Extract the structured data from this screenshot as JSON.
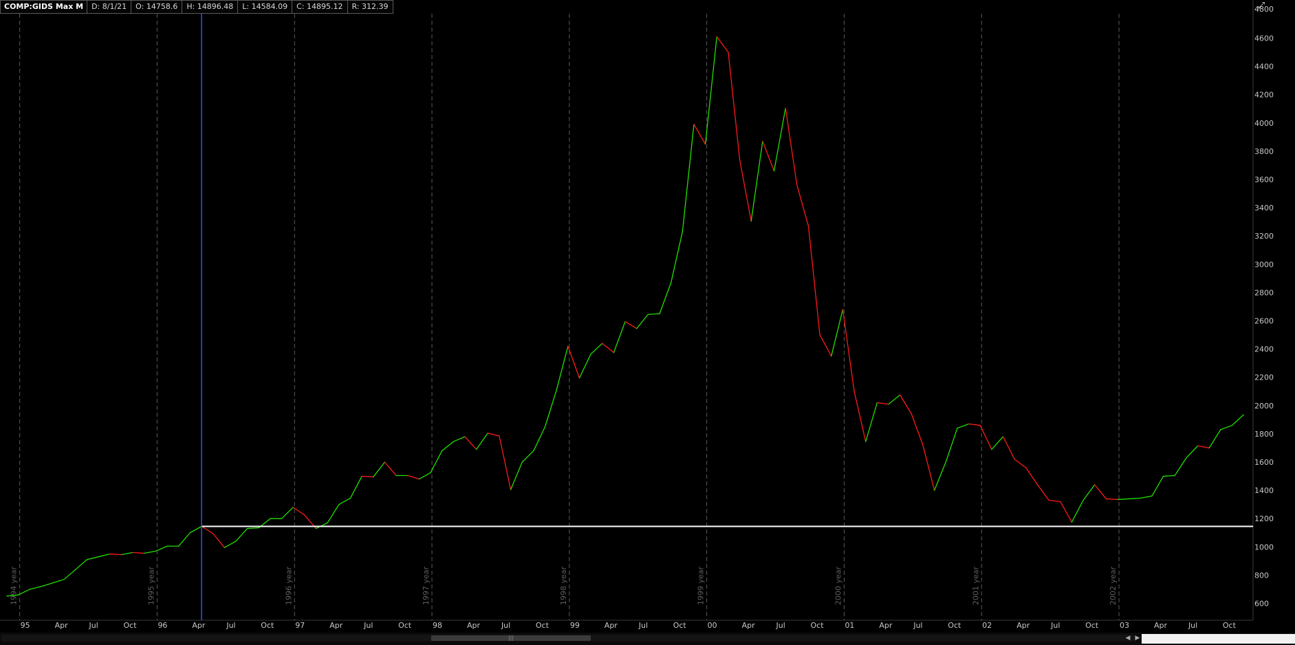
{
  "header": {
    "symbol": "COMP:GIDS Max M",
    "date": "D: 8/1/21",
    "open": "O: 14758.6",
    "high": "H: 14896.48",
    "low": "L: 14584.09",
    "close": "C: 14895.12",
    "range": "R: 312.39"
  },
  "colors": {
    "up": "#22e000",
    "down": "#ff1a1a",
    "background": "#000000",
    "axis_text": "#c8c8c8",
    "vertical_cursor": "#2a54ff",
    "horizontal_line": "#ffffff",
    "year_separator": "#5a5a5a",
    "year_label": "#5e5e5e"
  },
  "chart_data": {
    "type": "line",
    "ylim": [
      520,
      4720
    ],
    "y_ticks": [
      600,
      800,
      1000,
      1200,
      1400,
      1600,
      1800,
      2000,
      2200,
      2400,
      2600,
      2800,
      3000,
      3200,
      3400,
      3600,
      3800,
      4000,
      4200,
      4400,
      4600
    ],
    "y_tick_labels": [
      "600",
      "800",
      "1000",
      "1200",
      "1400",
      "1600",
      "1800",
      "2000",
      "2200",
      "2400",
      "2600",
      "2800",
      "3000",
      "3200",
      "3400",
      "3600",
      "3800",
      "4000",
      "4200",
      "4400",
      "4600"
    ],
    "top_partial_label": "4800",
    "x_start": "1994-12",
    "x_end": "2003-12",
    "x_tick_labels": [
      {
        "date": "1995-01",
        "label": "95"
      },
      {
        "date": "1995-04",
        "label": "Apr"
      },
      {
        "date": "1995-07",
        "label": "Jul"
      },
      {
        "date": "1995-10",
        "label": "Oct"
      },
      {
        "date": "1996-01",
        "label": "96"
      },
      {
        "date": "1996-04",
        "label": "Apr"
      },
      {
        "date": "1996-07",
        "label": "Jul"
      },
      {
        "date": "1996-10",
        "label": "Oct"
      },
      {
        "date": "1997-01",
        "label": "97"
      },
      {
        "date": "1997-04",
        "label": "Apr"
      },
      {
        "date": "1997-07",
        "label": "Jul"
      },
      {
        "date": "1997-10",
        "label": "Oct"
      },
      {
        "date": "1998-01",
        "label": "98"
      },
      {
        "date": "1998-04",
        "label": "Apr"
      },
      {
        "date": "1998-07",
        "label": "Jul"
      },
      {
        "date": "1998-10",
        "label": "Oct"
      },
      {
        "date": "1999-01",
        "label": "99"
      },
      {
        "date": "1999-04",
        "label": "Apr"
      },
      {
        "date": "1999-07",
        "label": "Jul"
      },
      {
        "date": "1999-10",
        "label": "Oct"
      },
      {
        "date": "2000-01",
        "label": "00"
      },
      {
        "date": "2000-04",
        "label": "Apr"
      },
      {
        "date": "2000-07",
        "label": "Jul"
      },
      {
        "date": "2000-10",
        "label": "Oct"
      },
      {
        "date": "2001-01",
        "label": "01"
      },
      {
        "date": "2001-04",
        "label": "Apr"
      },
      {
        "date": "2001-07",
        "label": "Jul"
      },
      {
        "date": "2001-10",
        "label": "Oct"
      },
      {
        "date": "2002-01",
        "label": "02"
      },
      {
        "date": "2002-04",
        "label": "Apr"
      },
      {
        "date": "2002-07",
        "label": "Jul"
      },
      {
        "date": "2002-10",
        "label": "Oct"
      },
      {
        "date": "2003-01",
        "label": "03"
      },
      {
        "date": "2003-04",
        "label": "Apr"
      },
      {
        "date": "2003-07",
        "label": "Jul"
      },
      {
        "date": "2003-10",
        "label": "Oct"
      }
    ],
    "year_separators": [
      {
        "date": "1995-01",
        "label": "1994 year"
      },
      {
        "date": "1996-01",
        "label": "1995 year"
      },
      {
        "date": "1997-01",
        "label": "1996 year"
      },
      {
        "date": "1998-01",
        "label": "1997 year"
      },
      {
        "date": "1999-01",
        "label": "1998 year"
      },
      {
        "date": "2000-01",
        "label": "1999 year"
      },
      {
        "date": "2001-01",
        "label": "2000 year"
      },
      {
        "date": "2002-01",
        "label": "2001 year"
      },
      {
        "date": "2003-01",
        "label": "2002 year"
      }
    ],
    "cursor_date": "1996-05",
    "horizontal_line_value": 1145,
    "x": [
      "1994-12",
      "1995-01",
      "1995-02",
      "1995-03",
      "1995-04",
      "1995-05",
      "1995-06",
      "1995-07",
      "1995-08",
      "1995-09",
      "1995-10",
      "1995-11",
      "1995-12",
      "1996-01",
      "1996-02",
      "1996-03",
      "1996-04",
      "1996-05",
      "1996-06",
      "1996-07",
      "1996-08",
      "1996-09",
      "1996-10",
      "1996-11",
      "1996-12",
      "1997-01",
      "1997-02",
      "1997-03",
      "1997-04",
      "1997-05",
      "1997-06",
      "1997-07",
      "1997-08",
      "1997-09",
      "1997-10",
      "1997-11",
      "1997-12",
      "1998-01",
      "1998-02",
      "1998-03",
      "1998-04",
      "1998-05",
      "1998-06",
      "1998-07",
      "1998-08",
      "1998-09",
      "1998-10",
      "1998-11",
      "1998-12",
      "1999-01",
      "1999-02",
      "1999-03",
      "1999-04",
      "1999-05",
      "1999-06",
      "1999-07",
      "1999-08",
      "1999-09",
      "1999-10",
      "1999-11",
      "1999-12",
      "2000-01",
      "2000-02",
      "2000-03",
      "2000-04",
      "2000-05",
      "2000-06",
      "2000-07",
      "2000-08",
      "2000-09",
      "2000-10",
      "2000-11",
      "2000-12",
      "2001-01",
      "2001-02",
      "2001-03",
      "2001-04",
      "2001-05",
      "2001-06",
      "2001-07",
      "2001-08",
      "2001-09",
      "2001-10",
      "2001-11",
      "2001-12",
      "2002-01",
      "2002-02",
      "2002-03",
      "2002-04",
      "2002-05",
      "2002-06",
      "2002-07",
      "2002-08",
      "2002-09",
      "2002-10",
      "2002-11",
      "2002-12",
      "2003-01",
      "2003-02",
      "2003-03",
      "2003-04",
      "2003-05",
      "2003-06",
      "2003-07",
      "2003-08",
      "2003-09",
      "2003-10",
      "2003-11",
      "2003-12"
    ],
    "series": [
      {
        "values": [
          652,
          660,
          700,
          720,
          745,
          770,
          840,
          910,
          930,
          950,
          945,
          960,
          955,
          970,
          1005,
          1005,
          1100,
          1145,
          1095,
          995,
          1040,
          1130,
          1135,
          1200,
          1200,
          1280,
          1225,
          1130,
          1170,
          1300,
          1345,
          1500,
          1495,
          1600,
          1505,
          1505,
          1480,
          1525,
          1680,
          1745,
          1780,
          1690,
          1805,
          1785,
          1405,
          1600,
          1680,
          1850,
          2110,
          2420,
          2195,
          2365,
          2440,
          2375,
          2595,
          2545,
          2645,
          2650,
          2870,
          3230,
          3990,
          3850,
          4610,
          4500,
          3740,
          3305,
          3870,
          3660,
          4105,
          3560,
          3270,
          2500,
          2350,
          2680,
          2100,
          1745,
          2020,
          2010,
          2075,
          1940,
          1720,
          1400,
          1600,
          1840,
          1870,
          1860,
          1690,
          1780,
          1620,
          1560,
          1440,
          1330,
          1320,
          1175,
          1330,
          1440,
          1340,
          1335,
          1340,
          1345,
          1360,
          1500,
          1505,
          1630,
          1715,
          1700,
          1830,
          1860,
          1935
        ]
      }
    ]
  }
}
